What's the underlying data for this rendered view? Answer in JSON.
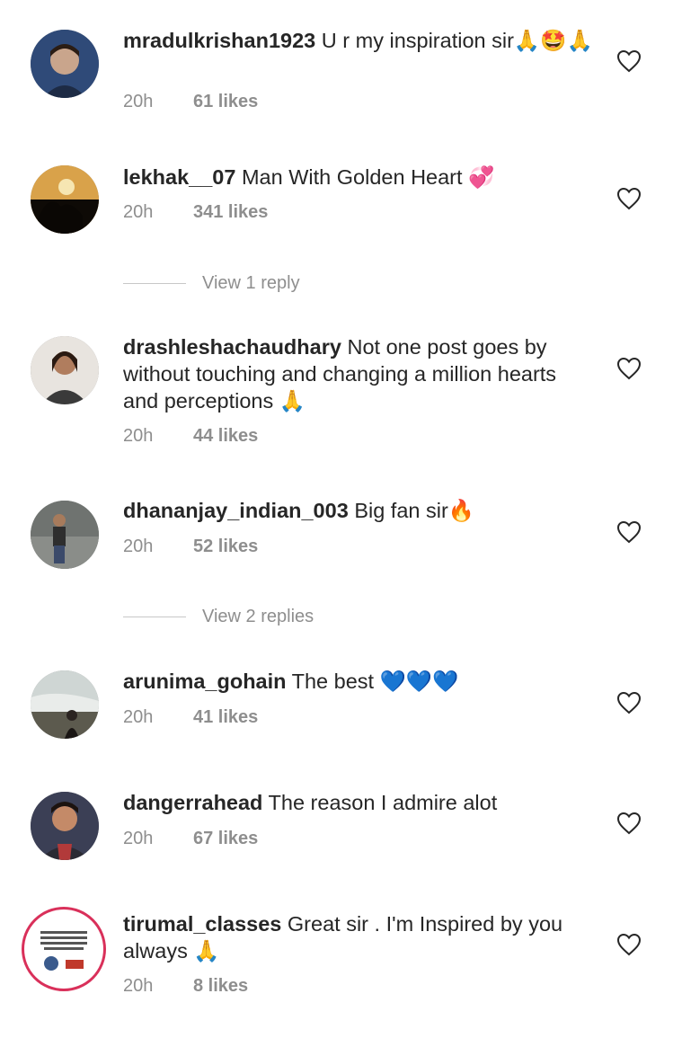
{
  "comments": [
    {
      "user": "mradulkrishan1923",
      "text": "U r my inspiration sir",
      "emoji": "🙏🤩🙏",
      "time": "20h",
      "likes": "61 likes"
    },
    {
      "user": "lekhak__07",
      "text": "Man With Golden Heart",
      "emoji": "💞",
      "time": "20h",
      "likes": "341 likes"
    },
    {
      "user": "drashleshachaudhary",
      "text": "Not one post goes by without touching and changing a million hearts and perceptions",
      "emoji": "🙏",
      "time": "20h",
      "likes": "44 likes"
    },
    {
      "user": "dhananjay_indian_003",
      "text": "Big fan sir",
      "emoji": "🔥",
      "time": "20h",
      "likes": "52 likes"
    },
    {
      "user": "arunima_gohain",
      "text": "The best",
      "emoji": "💙💙💙",
      "time": "20h",
      "likes": "41 likes"
    },
    {
      "user": "dangerrahead",
      "text": "The reason I admire alot",
      "emoji": "",
      "time": "20h",
      "likes": "67 likes"
    },
    {
      "user": "tirumal_classes",
      "text": "Great sir . I'm Inspired by you always",
      "emoji": "🙏",
      "time": "20h",
      "likes": "8 likes"
    }
  ],
  "replies": [
    {
      "label": "View 1 reply"
    },
    {
      "label": "View 2 replies"
    }
  ],
  "icons": {
    "like": "heart-outline-icon"
  },
  "colors": {
    "text": "#262626",
    "secondary": "#8e8e8e",
    "divider": "#c7c7c7"
  }
}
